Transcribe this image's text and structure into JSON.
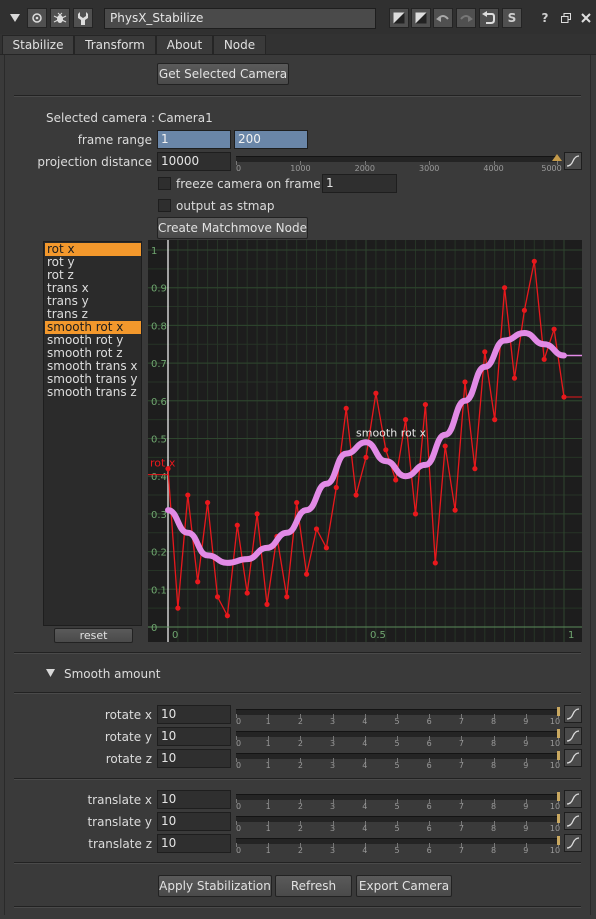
{
  "titlebar": {
    "node_name": "PhysX_Stabilize",
    "left_icons": [
      "collapse-triangle-icon",
      "node-center-icon",
      "bug-icon",
      "wrench-icon"
    ],
    "right_icons": [
      "diagonal-split-icon",
      "diagonal-split-alt-icon",
      "undo-icon",
      "redo-icon",
      "revert-icon",
      "s-icon"
    ],
    "s_label": "S",
    "help_label": "?",
    "window_icons": [
      "help-icon",
      "float-window-icon",
      "close-icon"
    ]
  },
  "tabs": [
    "Stabilize",
    "Transform",
    "About",
    "Node"
  ],
  "buttons": {
    "get_camera": "Get Selected Camera",
    "create_matchmove": "Create Matchmove Node",
    "reset": "reset",
    "apply": "Apply Stabilization",
    "refresh": "Refresh",
    "export": "Export Camera"
  },
  "camera": {
    "label": "Selected camera :",
    "value": "Camera1"
  },
  "frame_range": {
    "label": "frame range",
    "start": "1",
    "end": "200"
  },
  "projection": {
    "label": "projection distance",
    "value": "10000",
    "ticks": [
      "0",
      "1000",
      "2000",
      "3000",
      "4000",
      "5000"
    ],
    "slider_value": 10000,
    "slider_max": 5000
  },
  "freeze": {
    "label": "freeze camera on frame",
    "value": "1",
    "checked": false
  },
  "stmap": {
    "label": "output as stmap",
    "checked": false
  },
  "curves": {
    "items": [
      "rot x",
      "rot y",
      "rot z",
      "trans x",
      "trans y",
      "trans z",
      "smooth rot x",
      "smooth rot y",
      "smooth rot z",
      "smooth trans x",
      "smooth trans y",
      "smooth trans z"
    ],
    "selected": [
      "rot x",
      "smooth rot x"
    ]
  },
  "chart_data": {
    "type": "line",
    "xlim": [
      0,
      1
    ],
    "ylim": [
      0,
      1
    ],
    "x_ticks": [
      "0",
      "0.5",
      "1"
    ],
    "y_ticks": [
      "0",
      "0.1",
      "0.2",
      "0.3",
      "0.4",
      "0.5",
      "0.6",
      "0.7",
      "0.8",
      "0.9",
      "1"
    ],
    "grid": true,
    "background": "#1d1d1d",
    "grid_color": "#2e452e",
    "series": [
      {
        "name": "rot x",
        "color": "#e8181c",
        "label_position": "left",
        "x": [
          0.0,
          0.025,
          0.05,
          0.075,
          0.1,
          0.125,
          0.15,
          0.175,
          0.2,
          0.225,
          0.25,
          0.275,
          0.3,
          0.325,
          0.35,
          0.375,
          0.4,
          0.425,
          0.45,
          0.475,
          0.5,
          0.525,
          0.55,
          0.575,
          0.6,
          0.625,
          0.65,
          0.675,
          0.7,
          0.725,
          0.75,
          0.775,
          0.8,
          0.825,
          0.85,
          0.875,
          0.9,
          0.925,
          0.95,
          0.975,
          1.0
        ],
        "y": [
          0.42,
          0.05,
          0.35,
          0.12,
          0.33,
          0.08,
          0.03,
          0.27,
          0.09,
          0.3,
          0.06,
          0.24,
          0.08,
          0.33,
          0.14,
          0.26,
          0.21,
          0.37,
          0.58,
          0.35,
          0.45,
          0.62,
          0.47,
          0.39,
          0.55,
          0.3,
          0.59,
          0.17,
          0.48,
          0.31,
          0.65,
          0.42,
          0.73,
          0.55,
          0.9,
          0.66,
          0.84,
          0.97,
          0.71,
          0.79,
          0.61
        ]
      },
      {
        "name": "smooth rot x",
        "color": "#e28ae6",
        "label_position": "top",
        "x": [
          0.0,
          0.05,
          0.1,
          0.15,
          0.2,
          0.25,
          0.3,
          0.35,
          0.4,
          0.45,
          0.5,
          0.55,
          0.6,
          0.65,
          0.7,
          0.75,
          0.8,
          0.85,
          0.9,
          0.95,
          1.0
        ],
        "y": [
          0.31,
          0.25,
          0.19,
          0.17,
          0.18,
          0.21,
          0.25,
          0.31,
          0.38,
          0.46,
          0.49,
          0.44,
          0.4,
          0.43,
          0.51,
          0.6,
          0.69,
          0.76,
          0.78,
          0.75,
          0.72
        ]
      }
    ]
  },
  "smooth_amount": {
    "label": "Smooth amount",
    "ticks": [
      "0",
      "1",
      "2",
      "3",
      "4",
      "5",
      "6",
      "7",
      "8",
      "9",
      "10"
    ],
    "rotate": [
      {
        "label": "rotate x",
        "value": "10"
      },
      {
        "label": "rotate y",
        "value": "10"
      },
      {
        "label": "rotate z",
        "value": "10"
      }
    ],
    "translate": [
      {
        "label": "translate x",
        "value": "10"
      },
      {
        "label": "translate y",
        "value": "10"
      },
      {
        "label": "translate z",
        "value": "10"
      }
    ],
    "slider_max": 10
  }
}
